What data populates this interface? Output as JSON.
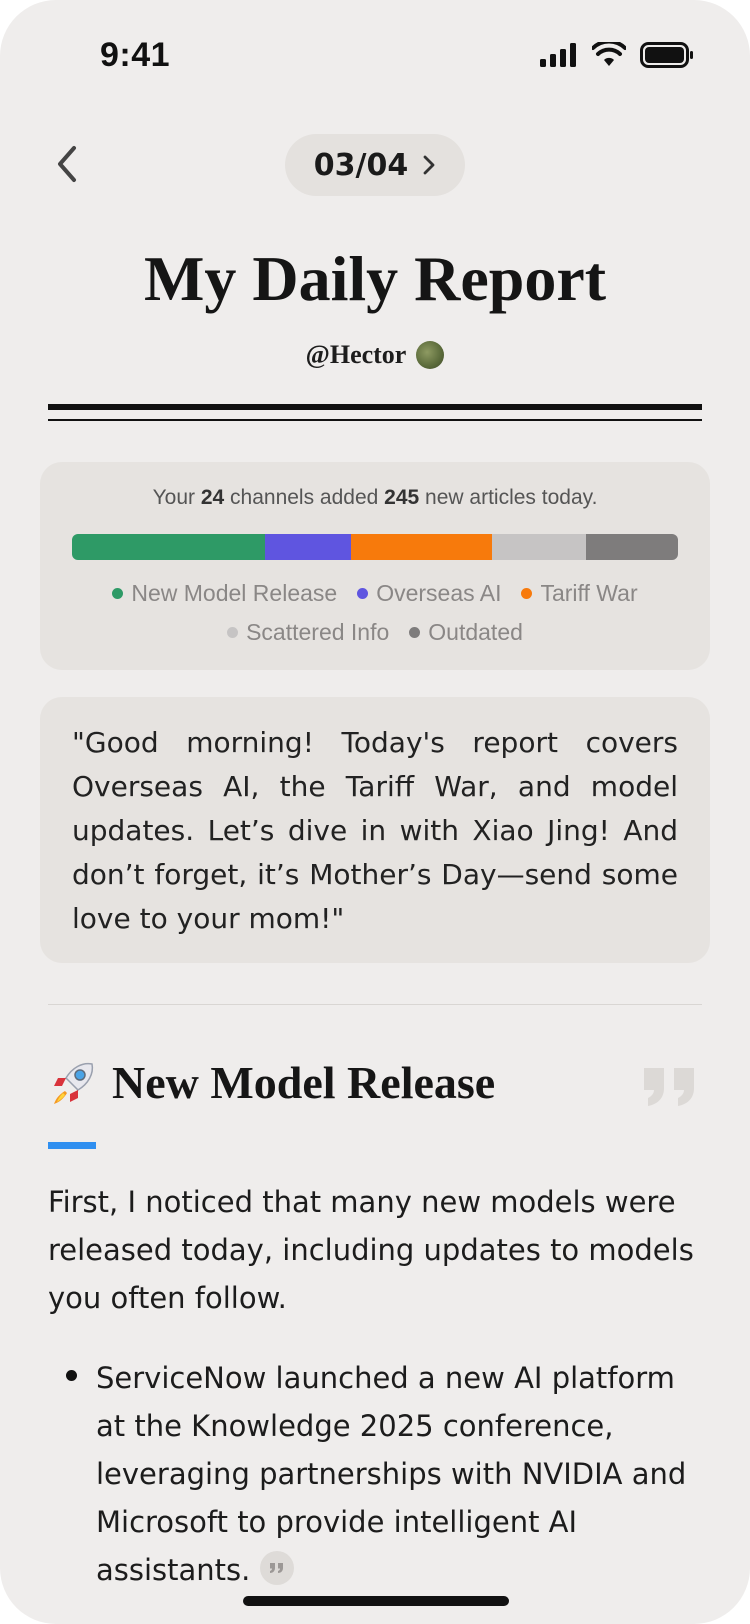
{
  "status_bar": {
    "time": "9:41"
  },
  "nav": {
    "pager": "03/04"
  },
  "header": {
    "title": "My Daily Report",
    "author": "@Hector"
  },
  "stats": {
    "prefix": "Your ",
    "channels": "24",
    "middle": " channels added ",
    "articles": "245",
    "suffix": " new articles today.",
    "segments": [
      {
        "label": "New Model Release",
        "color": "#2e9a66",
        "share": 0.318
      },
      {
        "label": "Overseas AI",
        "color": "#5f55e0",
        "share": 0.142
      },
      {
        "label": "Tariff War",
        "color": "#f77a0c",
        "share": 0.233
      },
      {
        "label": "Scattered Info",
        "color": "#c6c4c4",
        "share": 0.155
      },
      {
        "label": "Outdated",
        "color": "#7e7c7c",
        "share": 0.152
      }
    ]
  },
  "quote": {
    "text": "\"Good morning! Today's report covers Overseas AI, the Tariff War, and model updates. Let’s dive in with Xiao Jing! And don’t forget, it’s Mother’s Day—send some love to your mom!\""
  },
  "section": {
    "emoji": "rocket-icon",
    "title": "New Model Release",
    "accent_color": "#2f8ff0",
    "intro": "First, I noticed that many new models were released today, including updates to models you often follow.",
    "bullets": [
      "ServiceNow launched a new AI platform at the Knowledge 2025 conference, leveraging partnerships with NVIDIA and Microsoft to provide intelligent AI assistants."
    ]
  }
}
